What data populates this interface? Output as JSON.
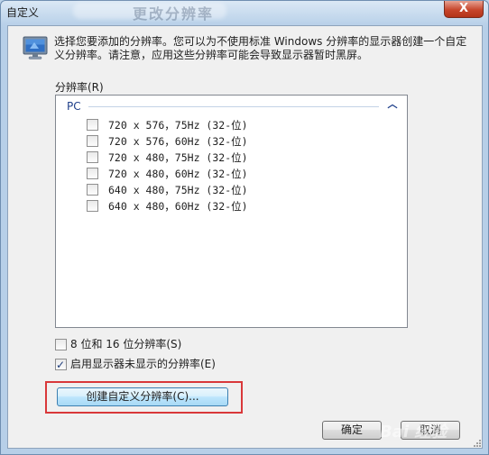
{
  "window": {
    "title": "自定义",
    "blurred_title": "更改分辨率",
    "close_label": "X"
  },
  "description": "选择您要添加的分辨率。您可以为不使用标准 Windows 分辨率的显示器创建一个自定义分辨率。请注意，应用这些分辨率可能会导致显示器暂时黑屏。",
  "resolution_list": {
    "label": "分辨率(R)",
    "group_header": "PC",
    "items": [
      {
        "text": "720 x 576，75Hz (32-位)",
        "checked": false
      },
      {
        "text": "720 x 576，60Hz (32-位)",
        "checked": false
      },
      {
        "text": "720 x 480，75Hz (32-位)",
        "checked": false
      },
      {
        "text": "720 x 480，60Hz (32-位)",
        "checked": false
      },
      {
        "text": "640 x 480，75Hz (32-位)",
        "checked": false
      },
      {
        "text": "640 x 480，60Hz (32-位)",
        "checked": false
      }
    ]
  },
  "options": {
    "bit8_16": {
      "label": "8 位和 16 位分辨率(S)",
      "checked": false
    },
    "unsupported": {
      "label": "启用显示器未显示的分辨率(E)",
      "checked": true
    }
  },
  "buttons": {
    "create_custom": "创建自定义分辨率(C)...",
    "ok": "确定",
    "cancel": "取消"
  },
  "watermark": "Bai 经验",
  "colors": {
    "highlight_box": "#d9383a",
    "group_header": "#1e3f8a",
    "window_frame": "#bcd3ea"
  }
}
